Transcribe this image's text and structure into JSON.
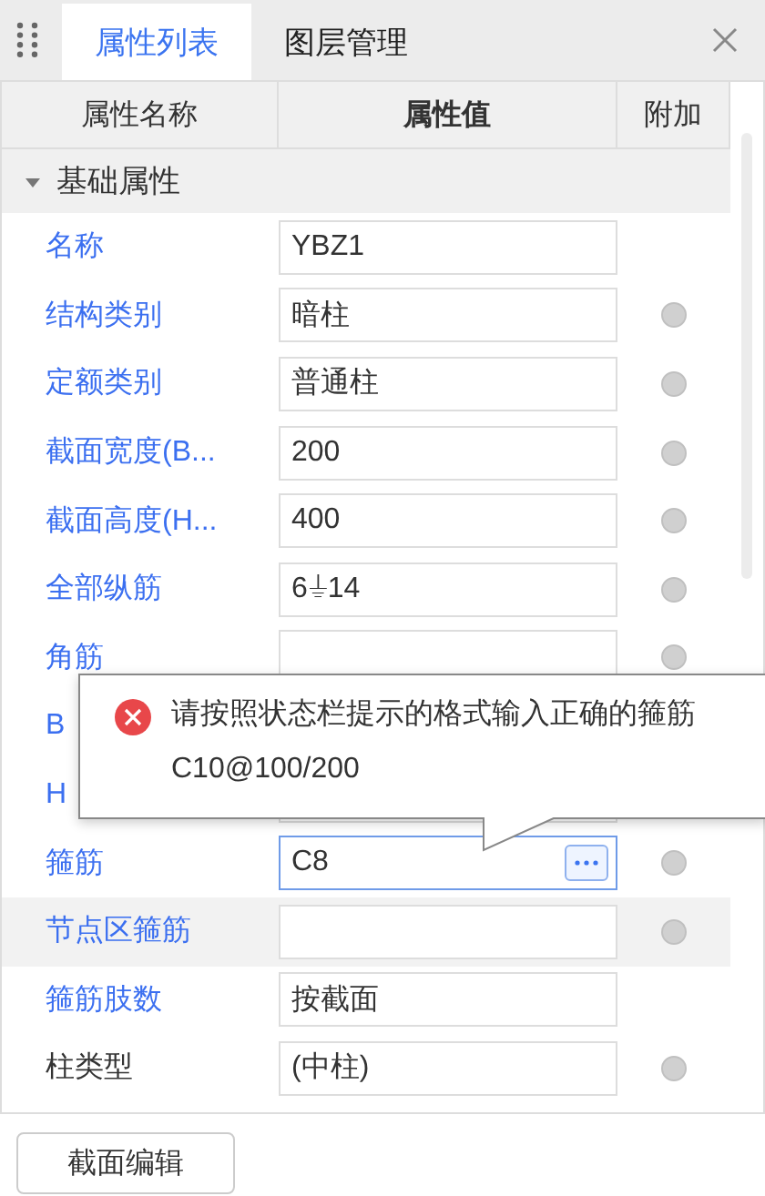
{
  "tabs": [
    {
      "label": "属性列表",
      "selected": true
    },
    {
      "label": "图层管理",
      "selected": false
    }
  ],
  "columns": [
    "属性名称",
    "属性值",
    "附加"
  ],
  "group": {
    "label": "基础属性",
    "expanded": true
  },
  "rows": [
    {
      "label": "名称",
      "value": "YBZ1",
      "public": true,
      "attach": false,
      "selected": false,
      "focused": false
    },
    {
      "label": "结构类别",
      "value": "暗柱",
      "public": true,
      "attach": true,
      "selected": false,
      "focused": false
    },
    {
      "label": "定额类别",
      "value": "普通柱",
      "public": true,
      "attach": true,
      "selected": false,
      "focused": false
    },
    {
      "label": "截面宽度(B...",
      "value": "200",
      "public": true,
      "attach": true,
      "selected": false,
      "focused": false
    },
    {
      "label": "截面高度(H...",
      "value": "400",
      "public": true,
      "attach": true,
      "selected": false,
      "focused": false
    },
    {
      "label": "全部纵筋",
      "value": "6⏚14",
      "public": true,
      "attach": true,
      "selected": false,
      "focused": false
    },
    {
      "label": "角筋",
      "public": true,
      "attach": true,
      "selected": false,
      "focused": false
    },
    {
      "label": "B",
      "public": true,
      "attach": false,
      "selected": false,
      "focused": false
    },
    {
      "label": "H",
      "public": true,
      "attach": false,
      "selected": false,
      "focused": false
    },
    {
      "label": "箍筋",
      "value": "C8",
      "public": true,
      "attach": true,
      "selected": false,
      "focused": true
    },
    {
      "label": "节点区箍筋",
      "public": true,
      "attach": true,
      "selected": true,
      "focused": false
    },
    {
      "label": "箍筋肢数",
      "value": "按截面",
      "public": true,
      "attach": false,
      "selected": false,
      "focused": false
    },
    {
      "label": "柱类型",
      "value": "(中柱)",
      "public": false,
      "attach": true,
      "selected": false,
      "focused": false
    }
  ],
  "tooltip": {
    "lines": [
      "请按照状态栏提示的格式输入正确的箍筋",
      "C10@100/200"
    ]
  },
  "footer_button": "截面编辑"
}
